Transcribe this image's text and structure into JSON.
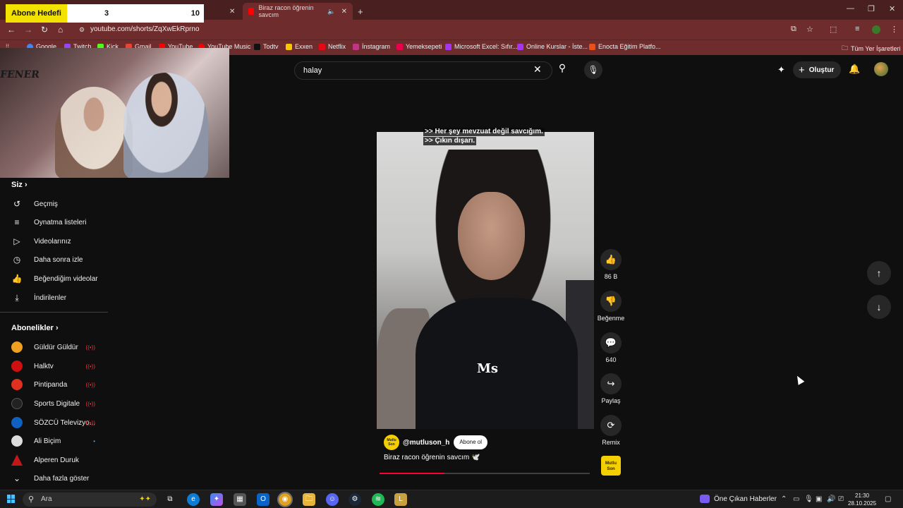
{
  "browser": {
    "tabs": [
      {
        "label": "Biraz racon öğrenin savcım",
        "audio_icon": "speaker-icon"
      }
    ],
    "new_tab": "+",
    "url": "youtube.com/shorts/ZqXwEkRprno",
    "bookmarks": [
      "Google",
      "Twitch",
      "Kick",
      "Gmail",
      "YouTube",
      "YouTube Music",
      "Todtv",
      "Exxen",
      "Netflix",
      "İnstagram",
      "Yemeksepeti",
      "Microsoft Excel: Sıfır...",
      "Online Kurslar - İste...",
      "Enocta Eğitim Platfo..."
    ],
    "all_bookmarks": "Tüm Yer İşaretleri"
  },
  "overlay": {
    "goal_label": "Abone Hedefi",
    "goal_current": "3",
    "goal_target": "10",
    "banner": "FENER"
  },
  "youtube": {
    "search_value": "halay",
    "create_label": "Oluştur",
    "sidebar": {
      "you_header": "Siz",
      "you_items": [
        {
          "label": "Geçmiş",
          "icon": "history-icon"
        },
        {
          "label": "Oynatma listeleri",
          "icon": "playlist-icon"
        },
        {
          "label": "Videolarınız",
          "icon": "video-icon"
        },
        {
          "label": "Daha sonra izle",
          "icon": "clock-icon"
        },
        {
          "label": "Beğendiğim videolar",
          "icon": "like-icon"
        },
        {
          "label": "İndirilenler",
          "icon": "download-icon"
        }
      ],
      "subs_header": "Abonelikler",
      "subs": [
        {
          "label": "Güldür Güldür",
          "live": true
        },
        {
          "label": "Halktv",
          "live": true
        },
        {
          "label": "Pintipanda",
          "live": true
        },
        {
          "label": "Sports Digitale",
          "live": true
        },
        {
          "label": "SÖZCÜ Televizyo...",
          "live": true
        },
        {
          "label": "Ali Biçim",
          "live": false
        },
        {
          "label": "Alperen Duruk",
          "live": false
        }
      ],
      "show_more": "Daha fazla göster"
    },
    "short": {
      "caption_line1": ">> Her şey mevzuat değil savcığım.",
      "caption_line2": ">> Çıkın dışarı.",
      "logo_text": "Ms",
      "channel": "@mutluson_h",
      "channel_avatar_text": "Mutlu Son",
      "subscribe": "Abone ol",
      "title": "Biraz racon öğrenin savcım 🕊️",
      "progress": 0.31,
      "likes": "86 B",
      "dislike_label": "Beğenme",
      "comments": "640",
      "share_label": "Paylaş",
      "remix_label": "Remix"
    }
  },
  "taskbar": {
    "search_placeholder": "Ara",
    "news": "Öne Çıkan Haberler",
    "time": "21:30",
    "date": "28.10.2025"
  },
  "colors": {
    "chrome_frame": "#4a1f1f",
    "chrome_toolbar": "#6e2c2c",
    "yt_bg": "#0f0f0f",
    "progress": "#ff0033",
    "live": "#ee3333"
  }
}
